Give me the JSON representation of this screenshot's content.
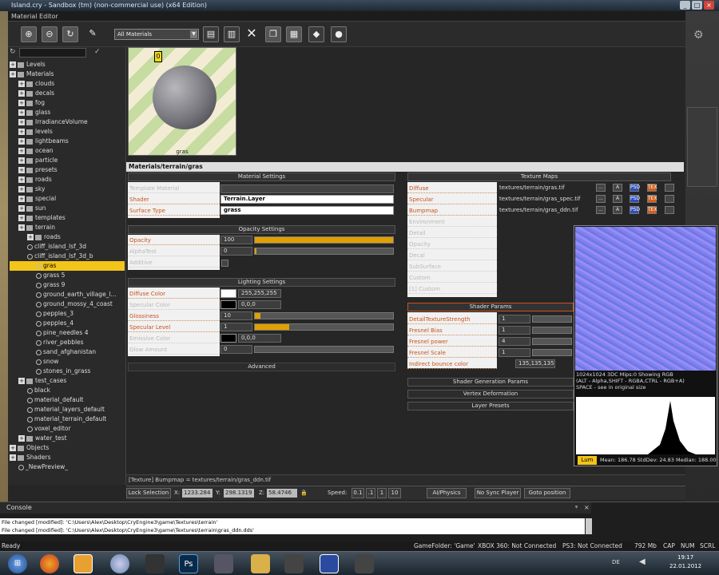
{
  "outer_title": "Island.cry - Sandbox (tm) (non-commercial use) (x64 Edition)",
  "editor_title": "Material Editor",
  "toolbar": {
    "filter": "All Materials"
  },
  "tree": {
    "items": [
      {
        "label": "Levels",
        "indent": 0,
        "kind": "folder"
      },
      {
        "label": "Materials",
        "indent": 0,
        "kind": "folder"
      },
      {
        "label": "clouds",
        "indent": 1,
        "kind": "folder"
      },
      {
        "label": "decals",
        "indent": 1,
        "kind": "folder"
      },
      {
        "label": "fog",
        "indent": 1,
        "kind": "folder"
      },
      {
        "label": "glass",
        "indent": 1,
        "kind": "folder"
      },
      {
        "label": "IrradianceVolume",
        "indent": 1,
        "kind": "folder"
      },
      {
        "label": "levels",
        "indent": 1,
        "kind": "folder"
      },
      {
        "label": "lightbeams",
        "indent": 1,
        "kind": "folder"
      },
      {
        "label": "ocean",
        "indent": 1,
        "kind": "folder"
      },
      {
        "label": "particle",
        "indent": 1,
        "kind": "folder"
      },
      {
        "label": "presets",
        "indent": 1,
        "kind": "folder"
      },
      {
        "label": "roads",
        "indent": 1,
        "kind": "folder"
      },
      {
        "label": "sky",
        "indent": 1,
        "kind": "folder"
      },
      {
        "label": "special",
        "indent": 1,
        "kind": "folder"
      },
      {
        "label": "sun",
        "indent": 1,
        "kind": "folder"
      },
      {
        "label": "templates",
        "indent": 1,
        "kind": "folder"
      },
      {
        "label": "terrain",
        "indent": 1,
        "kind": "folder"
      },
      {
        "label": "roads",
        "indent": 2,
        "kind": "folder"
      },
      {
        "label": "cliff_island_lsf_3d",
        "indent": 2,
        "kind": "mat"
      },
      {
        "label": "cliff_island_lsf_3d_b",
        "indent": 2,
        "kind": "mat"
      },
      {
        "label": "gras",
        "indent": 3,
        "kind": "mat",
        "selected": true
      },
      {
        "label": "grass 5",
        "indent": 3,
        "kind": "mat"
      },
      {
        "label": "grass 9",
        "indent": 3,
        "kind": "mat"
      },
      {
        "label": "ground_earth_village_l...",
        "indent": 3,
        "kind": "mat"
      },
      {
        "label": "ground_mossy_4_coast",
        "indent": 3,
        "kind": "mat"
      },
      {
        "label": "pepples_3",
        "indent": 3,
        "kind": "mat"
      },
      {
        "label": "pepples_4",
        "indent": 3,
        "kind": "mat"
      },
      {
        "label": "pine_needles 4",
        "indent": 3,
        "kind": "mat"
      },
      {
        "label": "river_pebbles",
        "indent": 3,
        "kind": "mat"
      },
      {
        "label": "sand_afghanistan",
        "indent": 3,
        "kind": "mat"
      },
      {
        "label": "snow",
        "indent": 3,
        "kind": "mat"
      },
      {
        "label": "stones_in_grass",
        "indent": 3,
        "kind": "mat"
      },
      {
        "label": "test_cases",
        "indent": 1,
        "kind": "folder"
      },
      {
        "label": "black",
        "indent": 2,
        "kind": "mat"
      },
      {
        "label": "material_default",
        "indent": 2,
        "kind": "mat"
      },
      {
        "label": "material_layers_default",
        "indent": 2,
        "kind": "mat"
      },
      {
        "label": "material_terrain_default",
        "indent": 2,
        "kind": "mat"
      },
      {
        "label": "voxel_editor",
        "indent": 2,
        "kind": "mat"
      },
      {
        "label": "water_test",
        "indent": 1,
        "kind": "folder"
      },
      {
        "label": "Objects",
        "indent": 0,
        "kind": "folder"
      },
      {
        "label": "Shaders",
        "indent": 0,
        "kind": "folder"
      },
      {
        "label": "_NewPreview_",
        "indent": 1,
        "kind": "mat"
      }
    ]
  },
  "preview": {
    "label": "gras",
    "marker": "0"
  },
  "path_bar": "Materials/terrain/gras",
  "material_settings": {
    "title": "Material Settings",
    "template_label": "Template Material",
    "shader_label": "Shader",
    "shader_value": "Terrain.Layer",
    "surface_label": "Surface Type",
    "surface_value": "grass"
  },
  "opacity_settings": {
    "title": "Opacity Settings",
    "opacity_label": "Opacity",
    "opacity_value": "100",
    "alphatest_label": "AlphaTest",
    "alphatest_value": "0",
    "additive_label": "Additive"
  },
  "lighting_settings": {
    "title": "Lighting Settings",
    "diffuse_label": "Diffuse Color",
    "diffuse_value": "255,255,255",
    "specular_label": "Specular Color",
    "specular_value": "0,0,0",
    "glossiness_label": "Glossiness",
    "glossiness_value": "10",
    "speclevel_label": "Specular Level",
    "speclevel_value": "1",
    "emissive_label": "Emissive Color",
    "emissive_value": "0,0,0",
    "glow_label": "Glow Amount",
    "glow_value": "0"
  },
  "advanced_label": "Advanced",
  "texture_maps": {
    "title": "Texture Maps",
    "rows": [
      {
        "label": "Diffuse",
        "path": "textures/terrain/gras.tif",
        "active": true
      },
      {
        "label": "Specular",
        "path": "textures/terrain/gras_spec.tif",
        "active": true
      },
      {
        "label": "Bumpmap",
        "path": "textures/terrain/gras_ddn.tif",
        "active": true
      },
      {
        "label": "Environment",
        "path": "",
        "active": false
      },
      {
        "label": "Detail",
        "path": "",
        "active": false
      },
      {
        "label": "Opacity",
        "path": "",
        "active": false
      },
      {
        "label": "Decal",
        "path": "",
        "active": false
      },
      {
        "label": "SubSurface",
        "path": "",
        "active": false
      },
      {
        "label": "Custom",
        "path": "",
        "active": false
      },
      {
        "label": "[1] Custom",
        "path": "",
        "active": false
      }
    ]
  },
  "shader_params": {
    "title": "Shader Params",
    "rows": [
      {
        "label": "DetailTextureStrength",
        "value": "1"
      },
      {
        "label": "Fresnel Bias",
        "value": "1"
      },
      {
        "label": "Fresnel power",
        "value": "4"
      },
      {
        "label": "Fresnel Scale",
        "value": "1"
      },
      {
        "label": "Indirect bounce color",
        "value": "135,135,135"
      }
    ]
  },
  "collapsed_sections": [
    "Shader Generation Params",
    "Vertex Deformation",
    "Layer Presets"
  ],
  "tex_popup": {
    "info1": "1024x1024 3DC Mips:0 Showing RGB",
    "info2": "(ALT - Alpha,SHIFT - RGBA,CTRL - RGB+A)",
    "info3": "SPACE - see in original size",
    "lum_button": "Lum",
    "stats": "Mean: 186.78 StdDev: 24.83 Median: 188.00"
  },
  "status_line": "[Texture] Bumpmap = textures/terrain/gras_ddn.tif",
  "lower_bar": {
    "lock_selection": "Lock Selection",
    "x_label": "X:",
    "x_value": "1233.284",
    "y_label": "Y:",
    "y_value": "298.1319",
    "z_label": "Z:",
    "z_value": "58.4746",
    "speed_label": "Speed:",
    "speed_values": [
      "0.1",
      ".1",
      "1",
      "10"
    ],
    "ai_physics": "AI/Physics",
    "no_sync": "No Sync Player",
    "goto": "Goto position"
  },
  "console": {
    "title": "Console",
    "lines": [
      "File changed [modified]: 'C:\\Users\\Alex\\Desktop\\CryEngine3\\game\\Textures\\terrain'",
      "File changed [modified]: 'C:\\Users\\Alex\\Desktop\\CryEngine3\\game\\Textures\\terrain\\gras_ddn.dds'"
    ]
  },
  "ready_bar": {
    "ready": "Ready",
    "game_folder": "GameFolder: 'Game'",
    "xbox": "XBOX 360: Not Connected",
    "ps3": "PS3: Not Connected",
    "mem": "792 Mb",
    "caps": "CAP",
    "num": "NUM",
    "scrl": "SCRL"
  },
  "taskbar": {
    "icons": [
      "windows-start-icon",
      "firefox-icon",
      "folder-icon",
      "explorer-icon",
      "winamp-icon",
      "photoshop-icon",
      "tool-icon",
      "files-icon",
      "sandbox-icon",
      "monitor-icon",
      "app-icon"
    ],
    "photoshop_label": "Ps",
    "lang": "DE",
    "time": "19:17",
    "date": "22.01.2012"
  },
  "colors": {
    "accent": "#f2c51a",
    "label_orange": "#c8531f",
    "normal_map": "#8286f0"
  }
}
